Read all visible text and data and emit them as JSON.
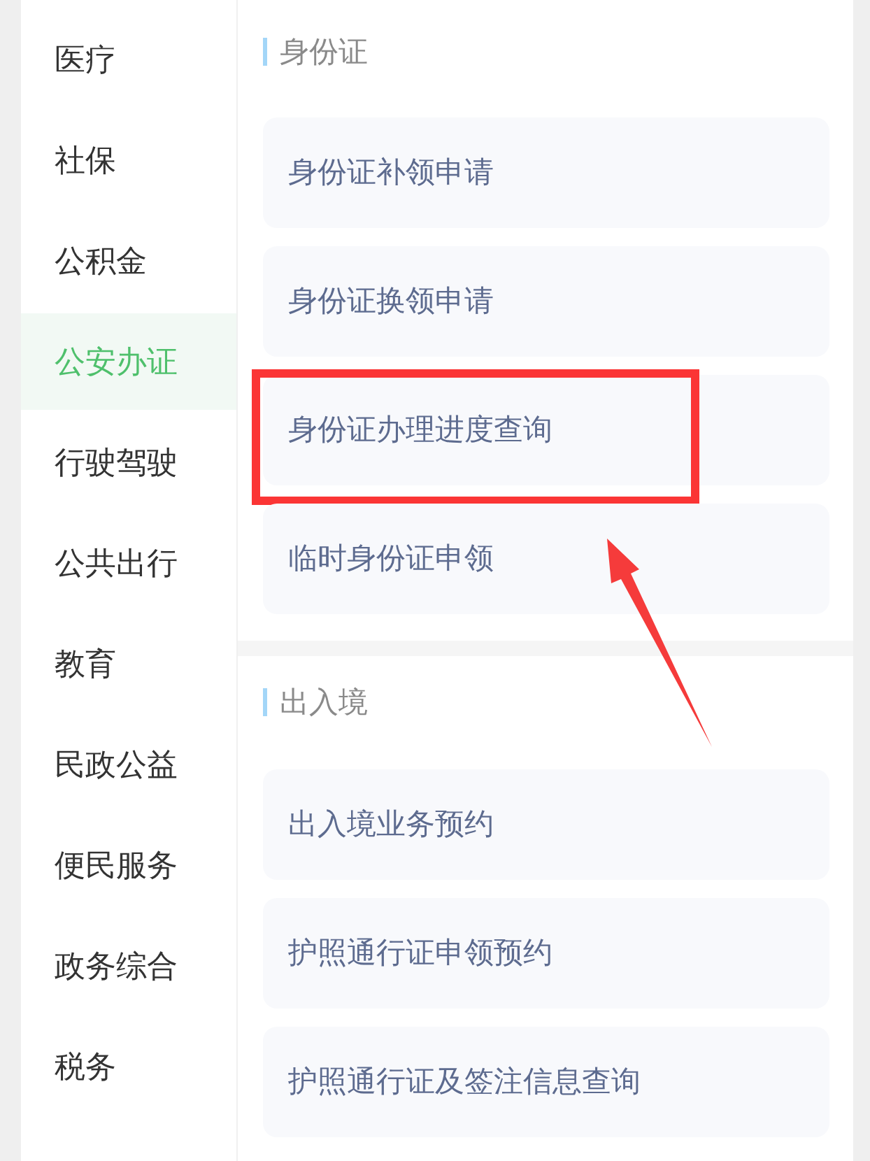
{
  "sidebar": {
    "items": [
      {
        "label": "医疗",
        "selected": false
      },
      {
        "label": "社保",
        "selected": false
      },
      {
        "label": "公积金",
        "selected": false
      },
      {
        "label": "公安办证",
        "selected": true
      },
      {
        "label": "行驶驾驶",
        "selected": false
      },
      {
        "label": "公共出行",
        "selected": false
      },
      {
        "label": "教育",
        "selected": false
      },
      {
        "label": "民政公益",
        "selected": false
      },
      {
        "label": "便民服务",
        "selected": false
      },
      {
        "label": "政务综合",
        "selected": false
      },
      {
        "label": "税务",
        "selected": false
      }
    ]
  },
  "sections": [
    {
      "title": "身份证",
      "items": [
        {
          "label": "身份证补领申请",
          "highlighted": false
        },
        {
          "label": "身份证换领申请",
          "highlighted": false
        },
        {
          "label": "身份证办理进度查询",
          "highlighted": true
        },
        {
          "label": "临时身份证申领",
          "highlighted": false
        }
      ]
    },
    {
      "title": "出入境",
      "items": [
        {
          "label": "出入境业务预约",
          "highlighted": false
        },
        {
          "label": "护照通行证申领预约",
          "highlighted": false
        },
        {
          "label": "护照通行证及签注信息查询",
          "highlighted": false
        }
      ]
    }
  ]
}
